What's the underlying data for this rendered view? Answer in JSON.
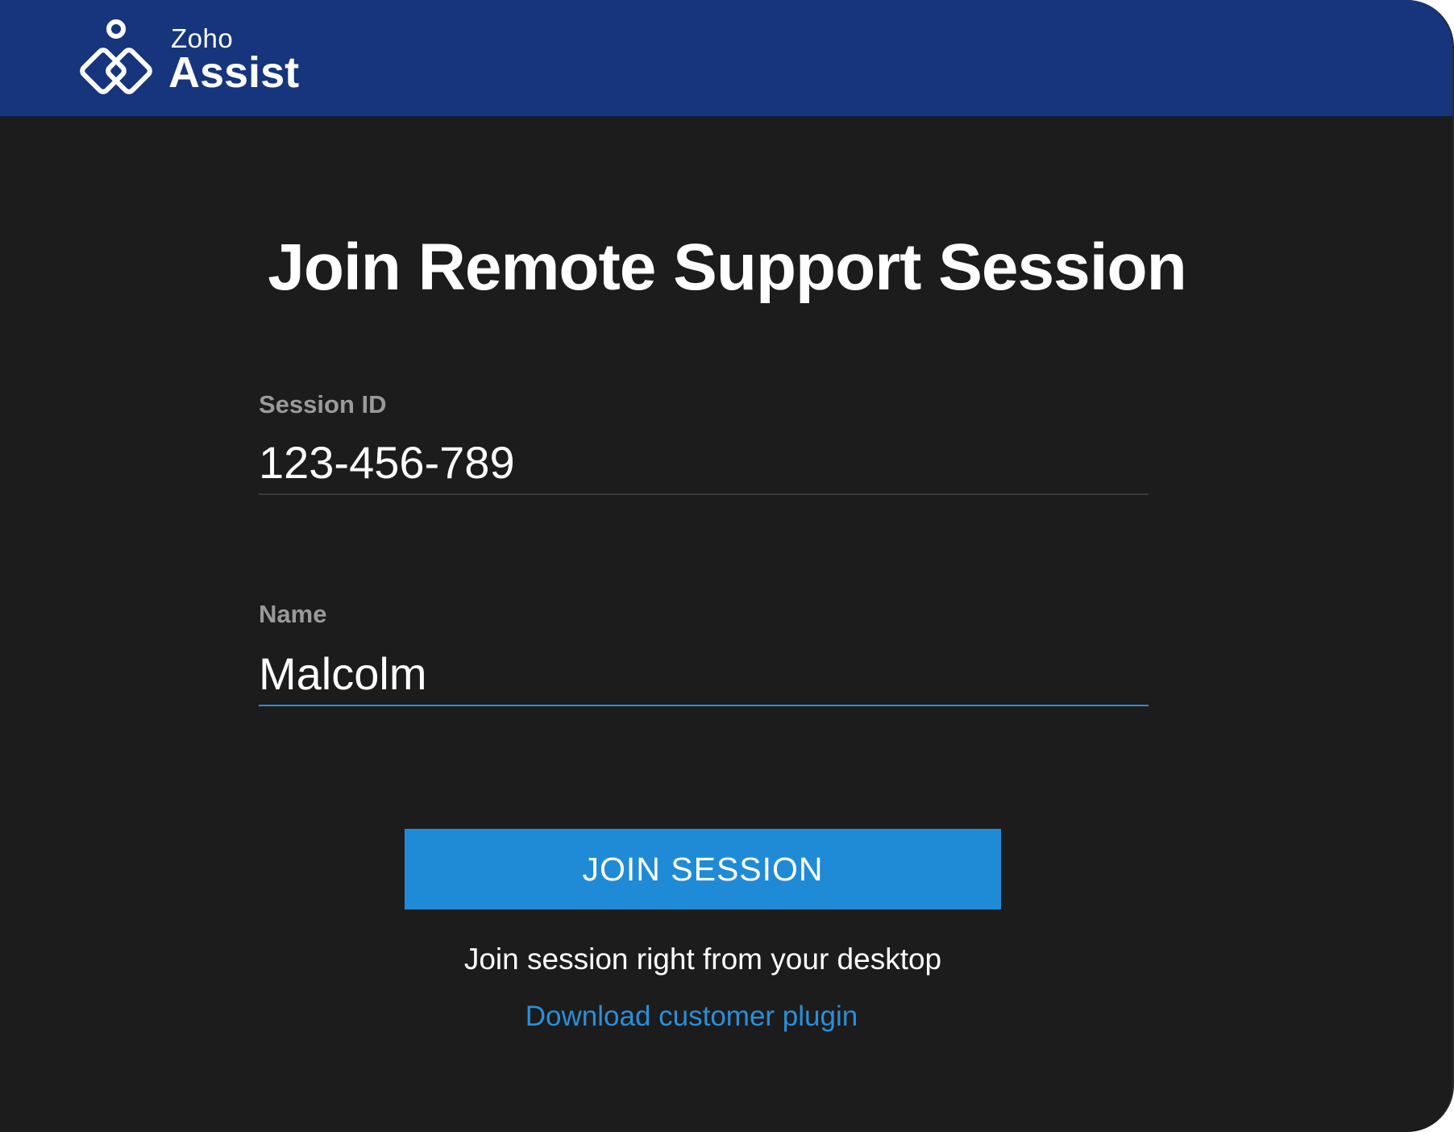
{
  "header": {
    "brand_name": "Zoho",
    "product_name": "Assist",
    "logo_icon": "zoho-assist-logo-icon"
  },
  "main": {
    "title": "Join Remote Support Session",
    "session_field": {
      "label": "Session ID",
      "value": "123-456-789"
    },
    "name_field": {
      "label": "Name",
      "value": "Malcolm",
      "focused": true
    },
    "join_button_label": "JOIN SESSION",
    "desktop_text": "Join session right from your desktop",
    "plugin_link_label": "Download customer plugin"
  },
  "colors": {
    "header_background": "#16357d",
    "page_background": "#1c1c1c",
    "accent": "#1f8bd7",
    "link": "#2a8fd8",
    "label": "#9a9a9a"
  }
}
